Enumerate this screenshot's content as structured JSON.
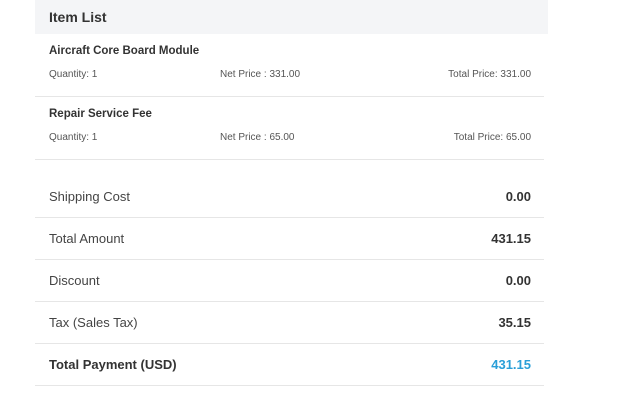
{
  "item_list": {
    "title": "Item List",
    "items": [
      {
        "name": "Aircraft Core Board Module",
        "quantity": "Quantity: 1",
        "net_price": "Net Price : 331.00",
        "total_price": "Total Price: 331.00"
      },
      {
        "name": "Repair Service Fee",
        "quantity": "Quantity: 1",
        "net_price": "Net Price : 65.00",
        "total_price": "Total Price: 65.00"
      }
    ]
  },
  "summary": {
    "shipping_label": "Shipping Cost",
    "shipping_value": "0.00",
    "total_amount_label": "Total Amount",
    "total_amount_value": "431.15",
    "discount_label": "Discount",
    "discount_value": "0.00",
    "tax_label": "Tax (Sales Tax)",
    "tax_value": "35.15",
    "total_payment_label": "Total Payment (USD)",
    "total_payment_value": "431.15"
  },
  "colors": {
    "accent": "#2a9fd8",
    "header_bg": "#f4f5f7",
    "divider": "#e6e6e6"
  }
}
